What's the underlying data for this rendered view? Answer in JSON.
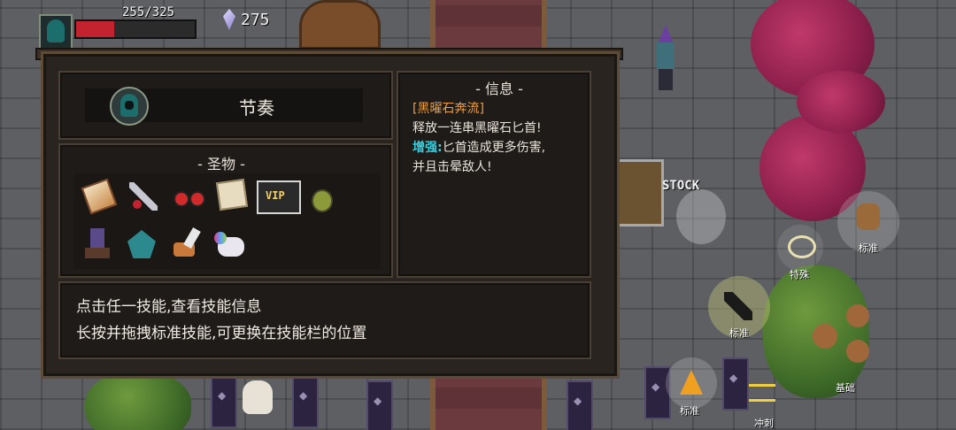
{
  "hud": {
    "hp_text": "255/325",
    "hp_fraction": 0.32,
    "gems": "275"
  },
  "skill": {
    "name": "节奏"
  },
  "relics": {
    "header": "- 圣物 -",
    "items": [
      {
        "icon": "spellbook-icon"
      },
      {
        "icon": "dagger-icon"
      },
      {
        "icon": "red-goggles-icon"
      },
      {
        "icon": "scroll-icon"
      },
      {
        "icon": "vip-card-icon",
        "text": "VIP"
      },
      {
        "icon": "potion-flask-icon"
      },
      {
        "icon": "purple-boot-icon"
      },
      {
        "icon": "teal-cloak-icon"
      },
      {
        "icon": "feather-gauntlet-icon"
      },
      {
        "icon": "unicorn-icon"
      }
    ]
  },
  "info": {
    "header": "- 信息 -",
    "skill_tag": "[黑曜石奔流]",
    "desc_line1": "释放一连串黑曜石匕首!",
    "enhance_label": "增强:",
    "enhance_text": "匕首造成更多伤害,",
    "desc_line3": "并且击晕敌人!"
  },
  "tips": {
    "line1": "点击任一技能,查看技能信息",
    "line2": "长按并拖拽标准技能,可更换在技能栏的位置"
  },
  "world": {
    "stock_label": "STOCK",
    "skill_labels": {
      "standard_top": "标准",
      "special": "特殊",
      "standard_mid": "标准",
      "basic": "基础",
      "standard_bottom": "标准",
      "dash": "冲刺"
    }
  },
  "colors": {
    "hp": "#c3222f",
    "highlight_orange": "#f0a040",
    "highlight_cyan": "#37d0e0",
    "panel_bg": "#29241f"
  }
}
